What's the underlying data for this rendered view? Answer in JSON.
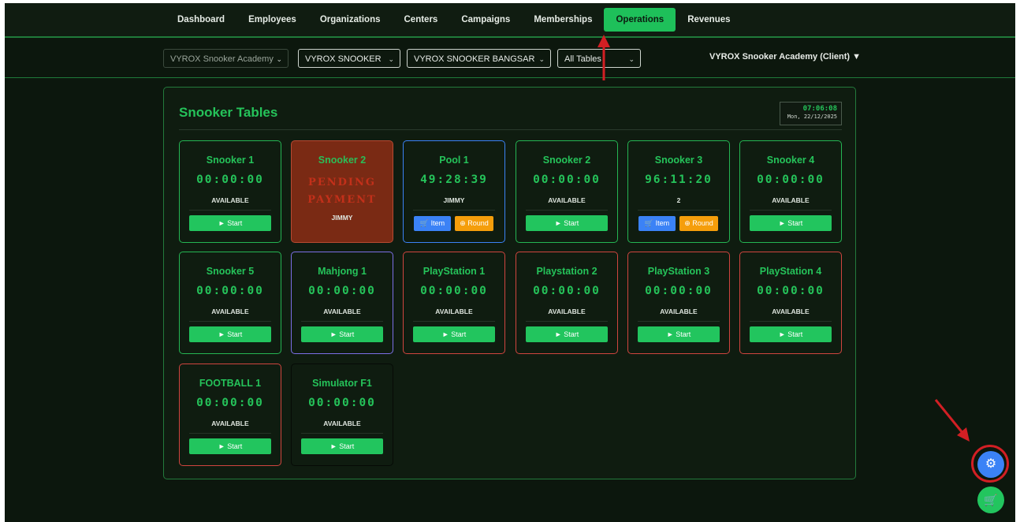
{
  "nav": {
    "items": [
      "Dashboard",
      "Employees",
      "Organizations",
      "Centers",
      "Campaigns",
      "Memberships",
      "Operations",
      "Revenues"
    ],
    "active": "Operations"
  },
  "filters": {
    "academy": "VYROX Snooker Academy",
    "organization": "VYROX SNOOKER",
    "center": "VYROX SNOOKER BANGSAR",
    "tables": "All Tables",
    "client": "VYROX Snooker Academy (Client) ▼"
  },
  "panel": {
    "title": "Snooker Tables",
    "clock_time": "07:06:08",
    "clock_date": "Mon, 22/12/2025"
  },
  "buttons": {
    "start": "► Start",
    "item": "🛒 Item",
    "round": "⊕ Round"
  },
  "cards": [
    {
      "name": "Snooker 1",
      "timer": "00:00:00",
      "status": "AVAILABLE",
      "kind": "start",
      "border": "green"
    },
    {
      "name": "Snooker 2",
      "timer": "",
      "pending": "PENDING PAYMENT",
      "status": "JIMMY",
      "kind": "none",
      "border": "pending"
    },
    {
      "name": "Pool 1",
      "timer": "49:28:39",
      "status": "JIMMY",
      "kind": "itemround",
      "border": "blue"
    },
    {
      "name": "Snooker 2",
      "timer": "00:00:00",
      "status": "AVAILABLE",
      "kind": "start",
      "border": "green"
    },
    {
      "name": "Snooker 3",
      "timer": "96:11:20",
      "status": "2",
      "kind": "itemround",
      "border": "green"
    },
    {
      "name": "Snooker 4",
      "timer": "00:00:00",
      "status": "AVAILABLE",
      "kind": "start",
      "border": "green"
    },
    {
      "name": "Snooker 5",
      "timer": "00:00:00",
      "status": "AVAILABLE",
      "kind": "start",
      "border": "green"
    },
    {
      "name": "Mahjong 1",
      "timer": "00:00:00",
      "status": "AVAILABLE",
      "kind": "start",
      "border": "purple"
    },
    {
      "name": "PlayStation 1",
      "timer": "00:00:00",
      "status": "AVAILABLE",
      "kind": "start",
      "border": "red"
    },
    {
      "name": "Playstation 2",
      "timer": "00:00:00",
      "status": "AVAILABLE",
      "kind": "start",
      "border": "red"
    },
    {
      "name": "PlayStation 3",
      "timer": "00:00:00",
      "status": "AVAILABLE",
      "kind": "start",
      "border": "red"
    },
    {
      "name": "PlayStation 4",
      "timer": "00:00:00",
      "status": "AVAILABLE",
      "kind": "start",
      "border": "red"
    },
    {
      "name": "FOOTBALL 1",
      "timer": "00:00:00",
      "status": "AVAILABLE",
      "kind": "start",
      "border": "red"
    },
    {
      "name": "Simulator F1",
      "timer": "00:00:00",
      "status": "AVAILABLE",
      "kind": "start",
      "border": "dark"
    }
  ],
  "fabs": {
    "settings_icon": "gear-icon",
    "cart_icon": "cart-icon"
  },
  "colors": {
    "accent": "#22c55e",
    "annotation": "#d21f24",
    "blue": "#3b82f6",
    "orange": "#f59e0b"
  }
}
